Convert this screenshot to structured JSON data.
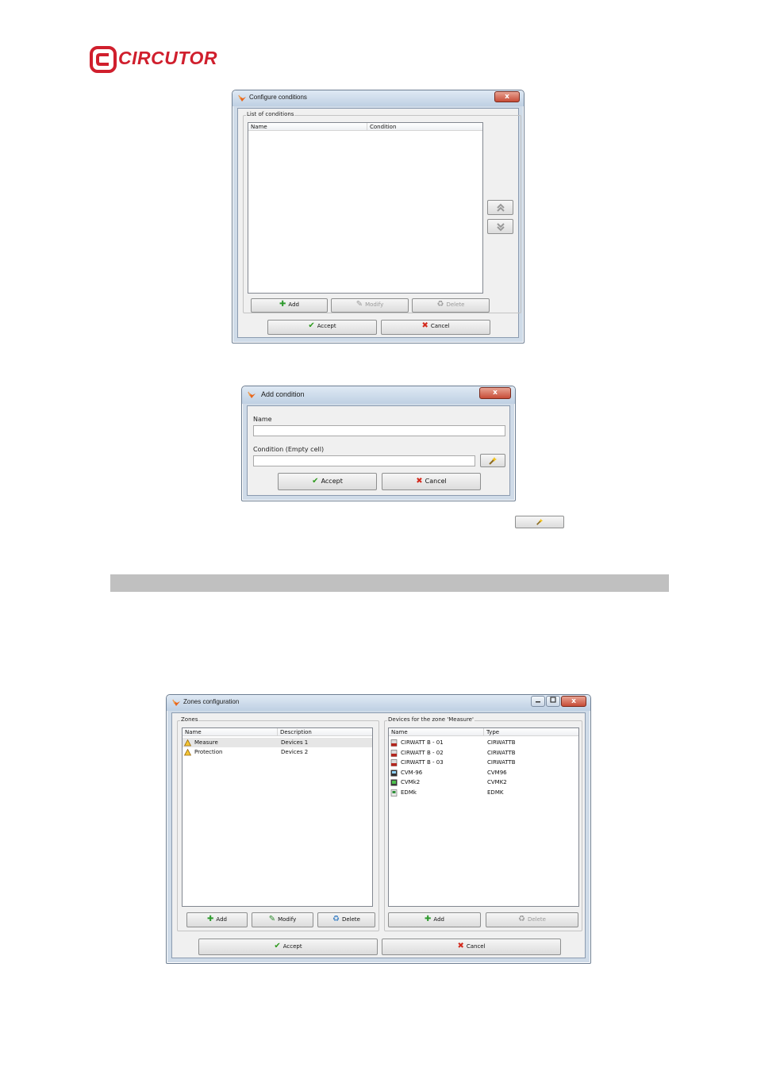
{
  "logo": {
    "text": "CIRCUTOR",
    "brand_color": "#d01f2d"
  },
  "configure_conditions": {
    "title": "Configure conditions",
    "close_glyph": "x",
    "group_label": "List of conditions",
    "columns": [
      "Name",
      "Condition"
    ],
    "buttons": {
      "add": "Add",
      "modify": "Modify",
      "delete": "Delete",
      "accept": "Accept",
      "cancel": "Cancel"
    }
  },
  "add_condition": {
    "title": "Add condition",
    "close_glyph": "x",
    "name_label": "Name",
    "name_value": "",
    "condition_label": "Condition (Empty cell)",
    "condition_value": "",
    "buttons": {
      "accept": "Accept",
      "cancel": "Cancel"
    }
  },
  "zones_configuration": {
    "title": "Zones configuration",
    "close_glyph": "x",
    "zones_group_label": "Zones",
    "zones_columns": [
      "Name",
      "Description"
    ],
    "zones": [
      {
        "name": "Measure",
        "description": "Devices 1",
        "selected": true
      },
      {
        "name": "Protection",
        "description": "Devices 2",
        "selected": false
      }
    ],
    "devices_group_label": "Devices for the zone 'Measure'",
    "devices_columns": [
      "Name",
      "Type"
    ],
    "devices": [
      {
        "name": "CIRWATT B - 01",
        "type": "CIRWATTB",
        "icon": "meter-icon"
      },
      {
        "name": "CIRWATT B - 02",
        "type": "CIRWATTB",
        "icon": "meter-icon"
      },
      {
        "name": "CIRWATT B - 03",
        "type": "CIRWATTB",
        "icon": "meter-icon"
      },
      {
        "name": "CVM-96",
        "type": "CVM96",
        "icon": "analyzer-icon"
      },
      {
        "name": "CVMk2",
        "type": "CVMK2",
        "icon": "analyzer-green-icon"
      },
      {
        "name": "EDMk",
        "type": "EDMK",
        "icon": "edmk-icon"
      }
    ],
    "buttons": {
      "add": "Add",
      "modify": "Modify",
      "delete": "Delete",
      "devices_add": "Add",
      "devices_delete": "Delete",
      "accept": "Accept",
      "cancel": "Cancel"
    }
  }
}
